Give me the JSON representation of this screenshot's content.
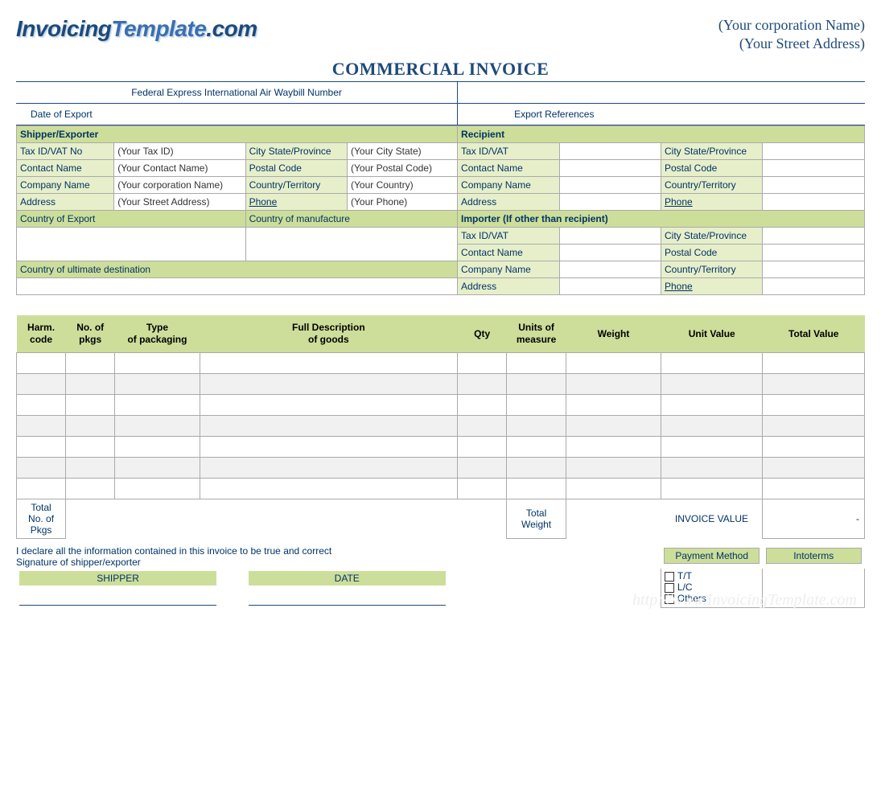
{
  "logo_text": "InvoicingTemplate.com",
  "corp_name": "(Your corporation  Name)",
  "corp_addr": "(Your Street Address)",
  "title": "COMMERCIAL INVOICE",
  "waybill_label": "Federal Express International Air Waybill Number",
  "date_export_label": "Date of Export",
  "export_refs_label": "Export References",
  "shipper": {
    "title": "Shipper/Exporter",
    "tax_lbl": "Tax ID/VAT No",
    "tax_val": "(Your Tax ID)",
    "contact_lbl": "Contact Name",
    "contact_val": "(Your Contact Name)",
    "company_lbl": "Company Name",
    "company_val": "(Your corporation  Name)",
    "address_lbl": "Address",
    "address_val": "(Your Street Address)",
    "city_lbl": "City  State/Province",
    "city_val": "(Your City State)",
    "postal_lbl": "Postal Code",
    "postal_val": "(Your Postal Code)",
    "country_lbl": "Country/Territory",
    "country_val": "(Your Country)",
    "phone_lbl": "Phone",
    "phone_val": "(Your Phone)"
  },
  "recipient": {
    "title": "Recipient",
    "tax_lbl": "Tax ID/VAT",
    "contact_lbl": "Contact Name",
    "company_lbl": "Company Name",
    "address_lbl": "Address",
    "city_lbl": "City  State/Province",
    "postal_lbl": "Postal Code",
    "country_lbl": "Country/Territory",
    "phone_lbl": "Phone"
  },
  "country_export_lbl": "Country of Export",
  "country_manuf_lbl": "Country of manufacture",
  "country_dest_lbl": "Country of ultimate destination",
  "importer": {
    "title": "Importer (If other than recipient)",
    "tax_lbl": "Tax ID/VAT",
    "contact_lbl": "Contact Name",
    "company_lbl": "Company Name",
    "address_lbl": "Address",
    "city_lbl": "City  State/Province",
    "postal_lbl": "Postal Code",
    "country_lbl": "Country/Territory",
    "phone_lbl": "Phone"
  },
  "items_headers": {
    "harm": "Harm.\ncode",
    "pkgs": "No. of\npkgs",
    "type": "Type\nof packaging",
    "desc": "Full Description\nof goods",
    "qty": "Qty",
    "uom": "Units of\nmeasure",
    "weight": "Weight",
    "unitval": "Unit Value",
    "totalval": "Total Value"
  },
  "totals": {
    "total_pkgs_lbl": "Total\nNo. of\nPkgs",
    "total_weight_lbl": "Total\nWeight",
    "invoice_value_lbl": "INVOICE VALUE",
    "invoice_value": "-"
  },
  "declaration": "I declare all the information contained in this invoice to be true and correct",
  "signature_lbl": "Signature of shipper/exporter",
  "shipper_sig": "SHIPPER",
  "date_sig": "DATE",
  "payment": {
    "method_hdr": "Payment Method",
    "intoterms_hdr": "Intoterms",
    "tt": "T/T",
    "lc": "L/C",
    "others": "Others"
  },
  "watermark": "http://www.InvoicingTemplate.com"
}
